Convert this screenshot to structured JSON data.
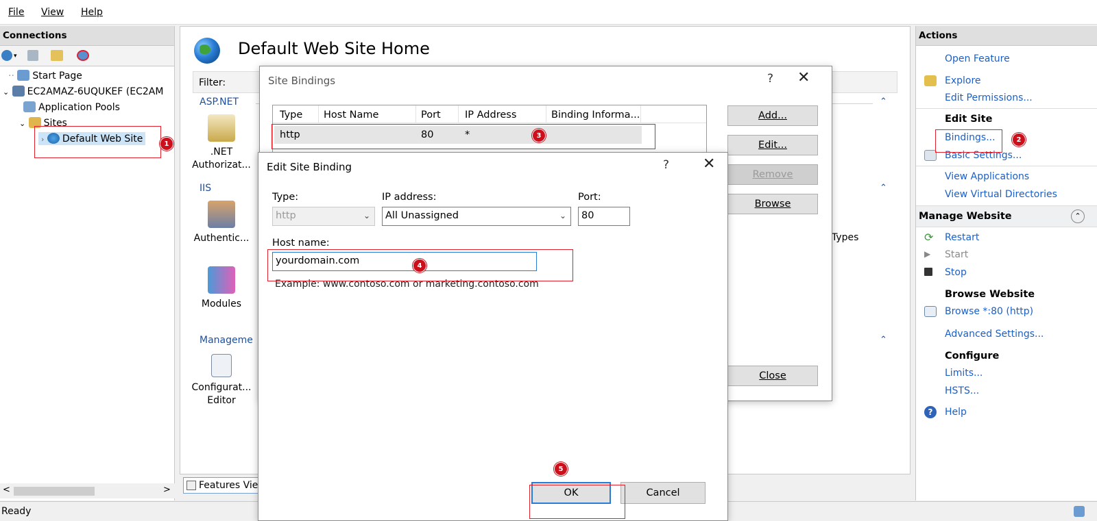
{
  "menu": [
    "File",
    "View",
    "Help"
  ],
  "connections": {
    "title": "Connections",
    "tree": [
      "Start Page",
      "EC2AMAZ-6UQUKEF (EC2AM",
      "Application Pools",
      "Sites",
      "Default Web Site"
    ]
  },
  "center": {
    "title": "Default Web Site Home",
    "filter_label": "Filter:",
    "groups": [
      "ASP.NET",
      "IIS",
      "Manageme"
    ],
    "features": {
      "authz_line1": ".NET",
      "authz_line2": "Authorizat...",
      "authentication": "Authentic...",
      "modules": "Modules",
      "config_line1": "Configurat...",
      "config_line2": "Editor",
      "types_partial": "Types"
    },
    "features_view_tab": "Features Vie"
  },
  "site_bindings": {
    "title": "Site Bindings",
    "help": "?",
    "columns": [
      "Type",
      "Host Name",
      "Port",
      "IP Address",
      "Binding Informa..."
    ],
    "rows": [
      {
        "type": "http",
        "host": "",
        "port": "80",
        "ip": "*",
        "info": ""
      }
    ],
    "buttons": {
      "add": "Add...",
      "edit": "Edit...",
      "remove": "Remove",
      "browse": "Browse",
      "close": "Close"
    }
  },
  "edit_binding": {
    "title": "Edit Site Binding",
    "help": "?",
    "type_label": "Type:",
    "type_value": "http",
    "ip_label": "IP address:",
    "ip_value": "All Unassigned",
    "port_label": "Port:",
    "port_value": "80",
    "host_label": "Host name:",
    "host_value": "yourdomain.com",
    "example": "Example: www.contoso.com or marketing.contoso.com",
    "ok": "OK",
    "cancel": "Cancel"
  },
  "actions": {
    "title": "Actions",
    "open_feature": "Open Feature",
    "explore": "Explore",
    "edit_permissions": "Edit Permissions...",
    "edit_site": "Edit Site",
    "bindings": "Bindings...",
    "basic_settings": "Basic Settings...",
    "view_applications": "View Applications",
    "view_virtual_dirs": "View Virtual Directories",
    "manage_website": "Manage Website",
    "restart": "Restart",
    "start": "Start",
    "stop": "Stop",
    "browse_website": "Browse Website",
    "browse_80": "Browse *:80 (http)",
    "advanced_settings": "Advanced Settings...",
    "configure": "Configure",
    "limits": "Limits...",
    "hsts": "HSTS...",
    "help": "Help"
  },
  "status": {
    "text": "Ready"
  },
  "annotations": [
    "1",
    "2",
    "3",
    "4",
    "5"
  ],
  "colors": {
    "accent_link": "#1a5fc8",
    "annotation_red": "#e0202a",
    "group_header": "#1f4e9b"
  }
}
